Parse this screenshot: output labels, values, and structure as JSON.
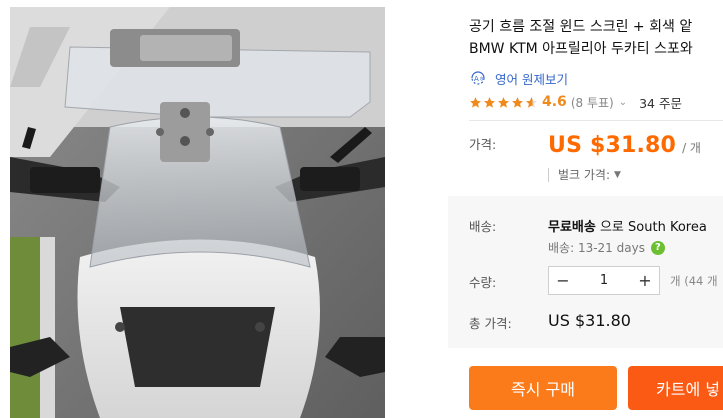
{
  "product": {
    "title_line1": "공기 흐름 조절 윈드 스크린 + 회색 앝",
    "title_line2": "BMW KTM 아프릴리아 두카티 스포와"
  },
  "translate": {
    "label": "영어 원제보기"
  },
  "rating": {
    "score": "4.6",
    "votes": "(8 투표)",
    "orders": "34 주문"
  },
  "price": {
    "label": "가격:",
    "value": "US $31.80",
    "unit": "/ 개",
    "bulk_label": "벌크 가격:"
  },
  "shipping": {
    "label": "배송:",
    "method": "무료배송",
    "connector": " 으로 ",
    "destination": "South Korea",
    "eta": "배송: 13-21 days"
  },
  "quantity": {
    "label": "수량:",
    "value": "1",
    "available": "개 (44 개"
  },
  "total": {
    "label": "총 가격:",
    "value": "US $31.80"
  },
  "actions": {
    "buy_now": "즉시 구매",
    "add_to_cart": "카트에 넣"
  },
  "colors": {
    "accent": "#ff6a00",
    "buy_button": "#fb7b1a",
    "cart_button": "#fa5a14",
    "link": "#3366cc",
    "star": "#f08a1c"
  },
  "icons": {
    "translate": "translate-icon",
    "star": "star-icon",
    "help": "help-icon",
    "minus": "minus-icon",
    "plus": "plus-icon"
  }
}
